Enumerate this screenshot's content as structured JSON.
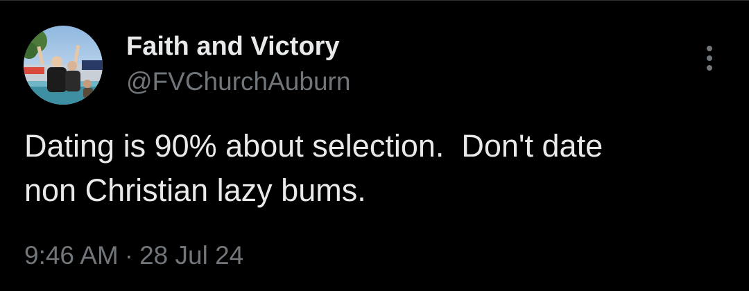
{
  "author": {
    "display_name": "Faith and Victory",
    "handle": "@FVChurchAuburn",
    "avatar_icon": "profile-photo-avatar"
  },
  "tweet": {
    "text": "Dating is 90% about selection.  Don't date\nnon Christian lazy bums."
  },
  "meta": {
    "time": "9:46 AM",
    "separator": "·",
    "date": "28 Jul 24"
  },
  "menu": {
    "icon": "vertical-more-icon"
  },
  "colors": {
    "background": "#000000",
    "primary_text": "#e7e9ea",
    "secondary_text": "#71767b",
    "divider": "#2f3336"
  }
}
